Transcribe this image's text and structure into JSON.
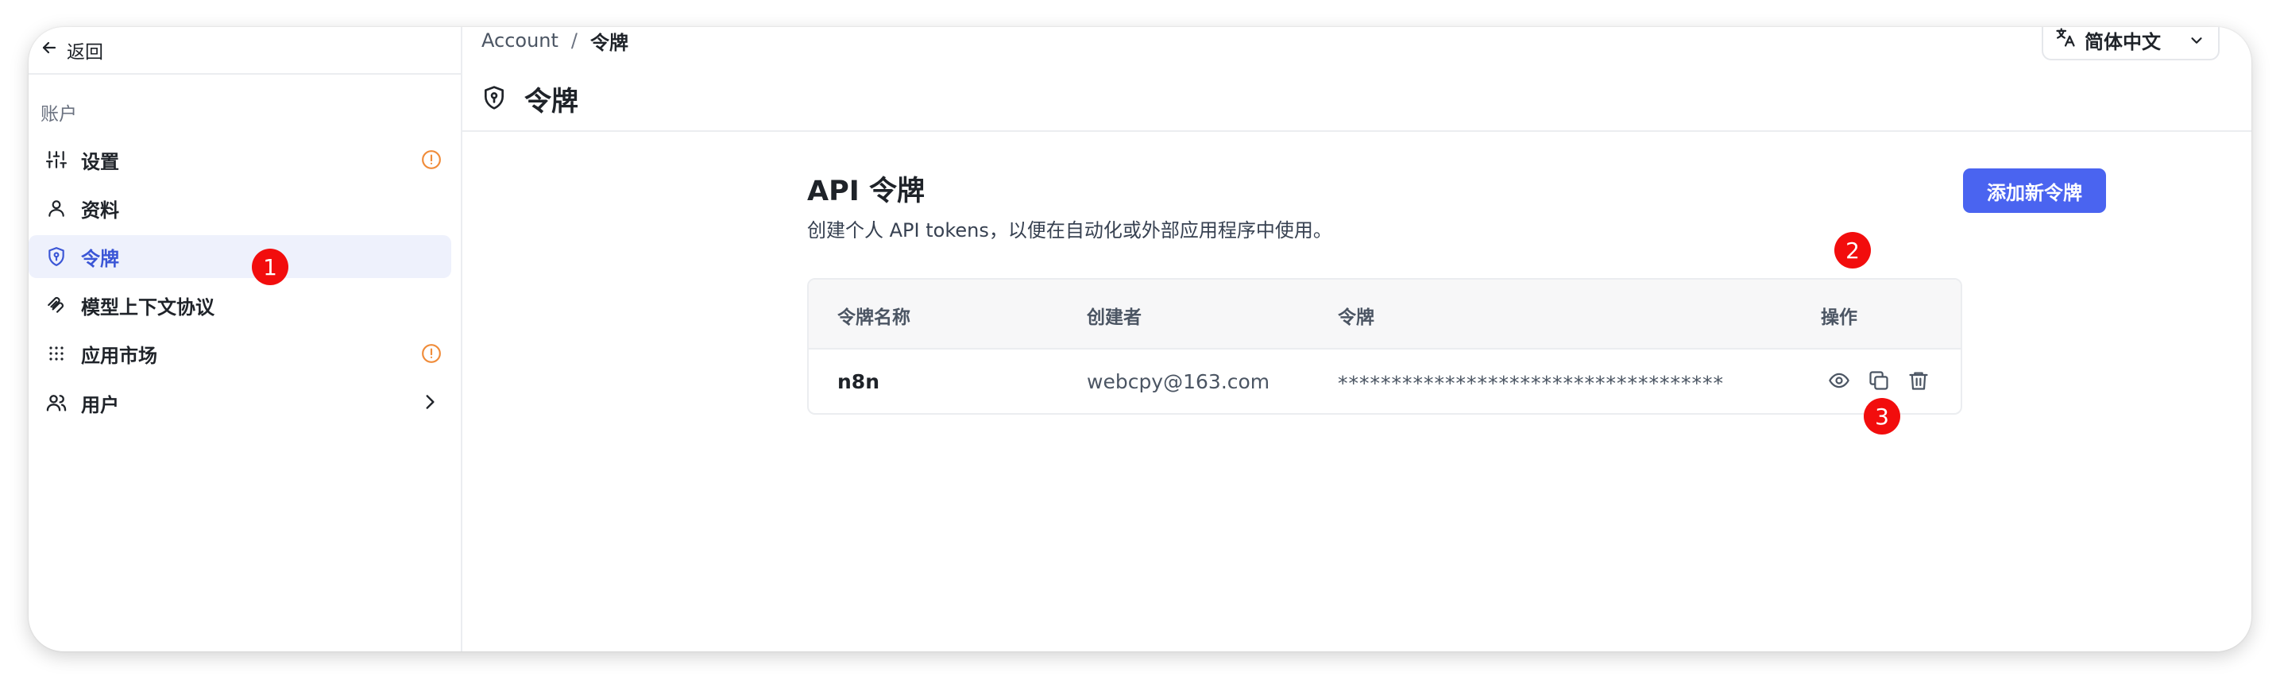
{
  "sidebar": {
    "back_label": "返回",
    "section_label": "账户",
    "items": [
      {
        "label": "设置",
        "icon": "sliders-icon",
        "warning": true
      },
      {
        "label": "资料",
        "icon": "user-icon"
      },
      {
        "label": "令牌",
        "icon": "shield-key-icon",
        "active": true
      },
      {
        "label": "模型上下文协议",
        "icon": "mcp-icon"
      },
      {
        "label": "应用市场",
        "icon": "grid-dots-icon",
        "warning": true
      },
      {
        "label": "用户",
        "icon": "users-icon",
        "has_submenu": true
      }
    ]
  },
  "header": {
    "breadcrumb": [
      "Account",
      "令牌"
    ],
    "breadcrumb_separator": "/",
    "page_title": "令牌",
    "language": "简体中文"
  },
  "api_tokens": {
    "title": "API 令牌",
    "description": "创建个人 API tokens，以便在自动化或外部应用程序中使用。",
    "add_button_label": "添加新令牌",
    "columns": [
      "令牌名称",
      "创建者",
      "令牌",
      "操作"
    ],
    "rows": [
      {
        "name": "n8n",
        "creator": "webcpy@163.com",
        "token": "************************************",
        "actions": [
          "eye-icon",
          "copy-icon",
          "trash-icon"
        ]
      }
    ]
  },
  "markers": [
    "1",
    "2",
    "3"
  ],
  "colors": {
    "accent": "#4a64f0",
    "active_bg": "#eef1fc",
    "active_text": "#3b56d6",
    "warning": "#f08c3a",
    "marker": "#f20d0d"
  }
}
